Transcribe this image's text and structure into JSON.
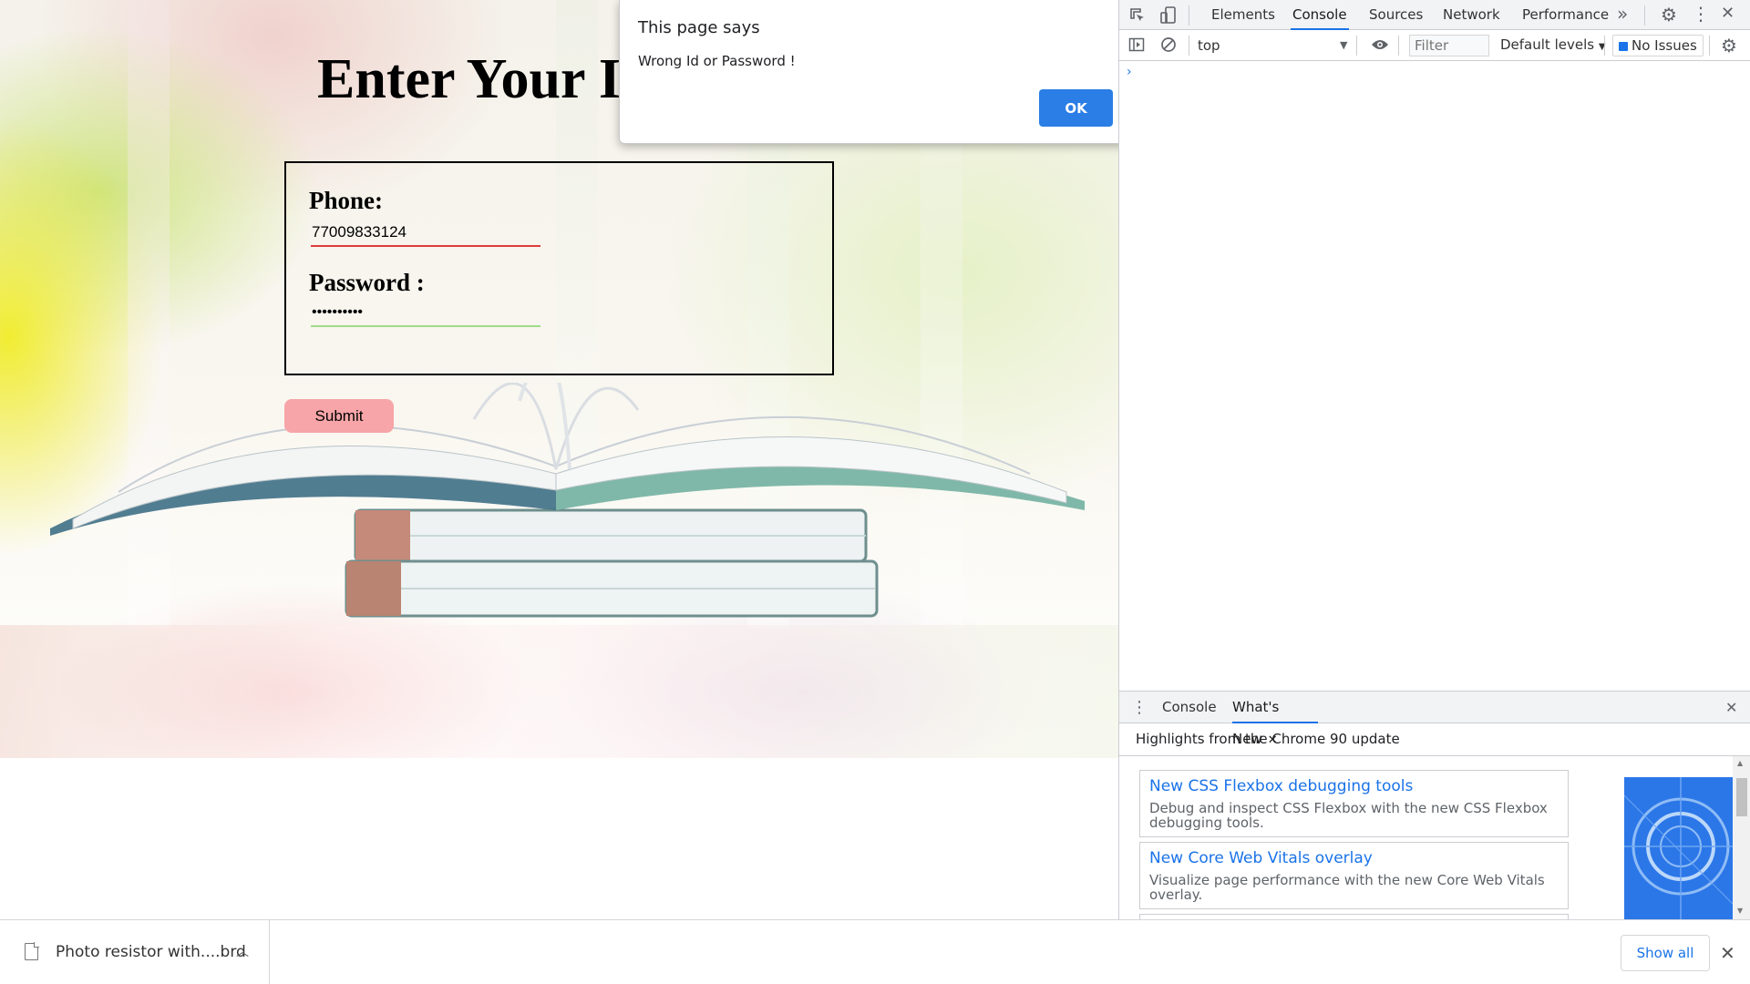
{
  "page": {
    "heading": "Enter Your I",
    "form": {
      "phone_label": "Phone:",
      "phone_value": "77009833124",
      "password_label": "Password :",
      "password_value": "••••••••••",
      "submit_label": "Submit"
    }
  },
  "alert": {
    "title": "This page says",
    "message": "Wrong Id or Password !",
    "ok_label": "OK"
  },
  "devtools": {
    "tabs": [
      "Elements",
      "Console",
      "Sources",
      "Network",
      "Performance"
    ],
    "active_tab": "Console",
    "more_tabs_glyph": "»",
    "context": "top",
    "filter_placeholder": "Filter",
    "levels_label": "Default levels",
    "issues_label": "No Issues",
    "prompt_glyph": "›",
    "drawer": {
      "tabs": [
        "Console",
        "What's New"
      ],
      "active_tab": "What's New",
      "highlights": "Highlights from the Chrome 90 update",
      "features": [
        {
          "title": "New CSS Flexbox debugging tools",
          "description": "Debug and inspect CSS Flexbox with the new CSS Flexbox debugging tools."
        },
        {
          "title": "New Core Web Vitals overlay",
          "description": "Visualize page performance with the new Core Web Vitals overlay."
        }
      ]
    },
    "colors": {
      "accent": "#1a73e8",
      "ok_button": "#2a7ee6",
      "submit_button": "#f7a5a8"
    }
  },
  "downloads": {
    "file_name": "Photo resistor with....brd",
    "show_all_label": "Show all"
  },
  "icons": {
    "inspect": "inspect-icon",
    "device": "device-toggle-icon",
    "settings": "gear-icon",
    "menu": "kebab-menu-icon",
    "close": "close-icon",
    "sidebar": "console-sidebar-icon",
    "clear": "clear-console-icon",
    "eye": "eye-icon"
  }
}
